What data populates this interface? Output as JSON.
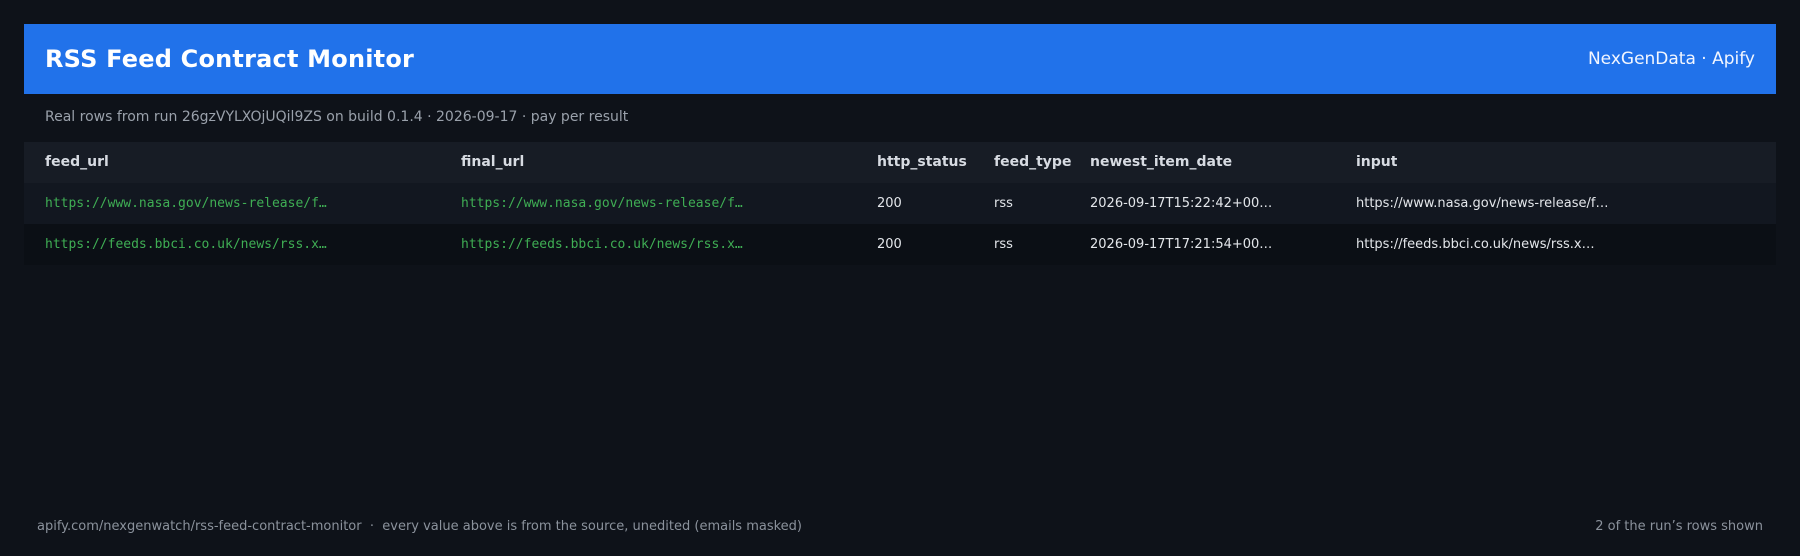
{
  "header": {
    "title": "RSS Feed Contract Monitor",
    "brand": "NexGenData · Apify"
  },
  "subtitle": "Real rows from run 26gzVYLXOjUQil9ZS on build 0.1.4 · 2026-09-17 · pay per result",
  "table": {
    "columns": [
      "feed_url",
      "final_url",
      "http_status",
      "feed_type",
      "newest_item_date",
      "input"
    ],
    "rows": [
      [
        "https://www.nasa.gov/news-release/f…",
        "https://www.nasa.gov/news-release/f…",
        "200",
        "rss",
        "2026-09-17T15:22:42+00…",
        "https://www.nasa.gov/news-release/f…"
      ],
      [
        "https://feeds.bbci.co.uk/news/rss.x…",
        "https://feeds.bbci.co.uk/news/rss.x…",
        "200",
        "rss",
        "2026-09-17T17:21:54+00…",
        "https://feeds.bbci.co.uk/news/rss.x…"
      ]
    ]
  },
  "footer": {
    "left": "apify.com/nexgenwatch/rss-feed-contract-monitor  ·  every value above is from the source, unedited (emails masked)",
    "right": "2 of the run’s rows shown"
  },
  "colors": {
    "header_bg": "#2172ea",
    "page_bg": "#0e1219",
    "url_green": "#3fae54"
  }
}
